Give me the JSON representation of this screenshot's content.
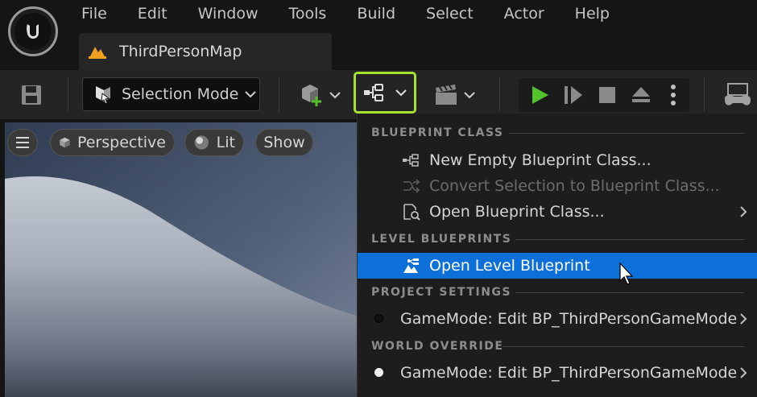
{
  "menubar": {
    "items": [
      "File",
      "Edit",
      "Window",
      "Tools",
      "Build",
      "Select",
      "Actor",
      "Help"
    ]
  },
  "tab": {
    "label": "ThirdPersonMap"
  },
  "toolbar": {
    "selection_mode_label": "Selection Mode"
  },
  "viewport": {
    "menu_icon": "hamburger-icon",
    "perspective_label": "Perspective",
    "lit_label": "Lit",
    "show_label": "Show"
  },
  "dropdown": {
    "sections": {
      "blueprint_class": "BLUEPRINT CLASS",
      "level_blueprints": "LEVEL BLUEPRINTS",
      "project_settings": "PROJECT SETTINGS",
      "world_override": "WORLD OVERRIDE"
    },
    "items": {
      "new_empty": "New Empty Blueprint Class...",
      "convert": "Convert Selection to Blueprint Class...",
      "open_class": "Open Blueprint Class...",
      "open_level": "Open Level Blueprint",
      "gamemode_project": "GameMode: Edit BP_ThirdPersonGameMode",
      "gamemode_world": "GameMode: Edit BP_ThirdPersonGameMode"
    }
  },
  "colors": {
    "highlight": "#0d70d9",
    "blueprint_button_border": "#a6e22e",
    "play_green": "#53c22b"
  }
}
